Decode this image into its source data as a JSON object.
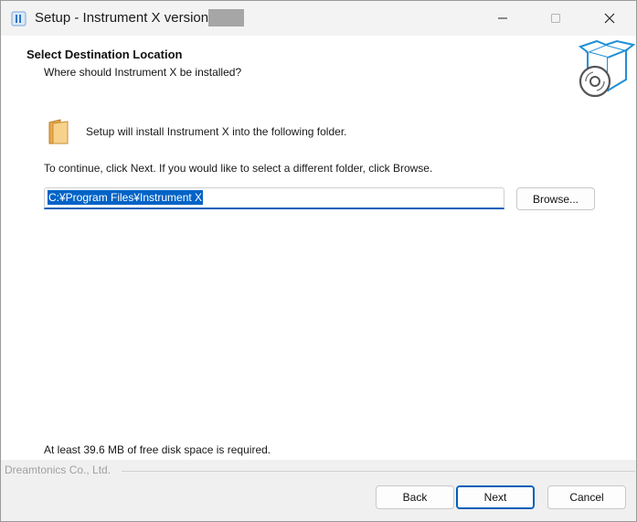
{
  "window": {
    "title": "Setup - Instrument X version",
    "icons": {
      "app": "setup-app-icon",
      "minimize": "minimize-icon",
      "maximize": "maximize-icon",
      "close": "close-icon"
    }
  },
  "header": {
    "title": "Select Destination Location",
    "subtitle": "Where should Instrument X be installed?",
    "icon": "install-box-disc-icon"
  },
  "content": {
    "folder_icon": "folder-icon",
    "folder_text": "Setup will install Instrument X into the following folder.",
    "continue_text": "To continue, click Next. If you would like to select a different folder, click Browse.",
    "path_value": "C:¥Program Files¥Instrument X",
    "browse_label": "Browse...",
    "disk_space_text": "At least 39.6 MB of free disk space is required."
  },
  "footer": {
    "brand": "Dreamtonics Co., Ltd.",
    "back_label": "Back",
    "next_label": "Next",
    "cancel_label": "Cancel"
  },
  "colors": {
    "accent": "#005fb8",
    "selection": "#0063c7",
    "folder": "#f5c46b",
    "icon_blue": "#1f8fd6"
  }
}
